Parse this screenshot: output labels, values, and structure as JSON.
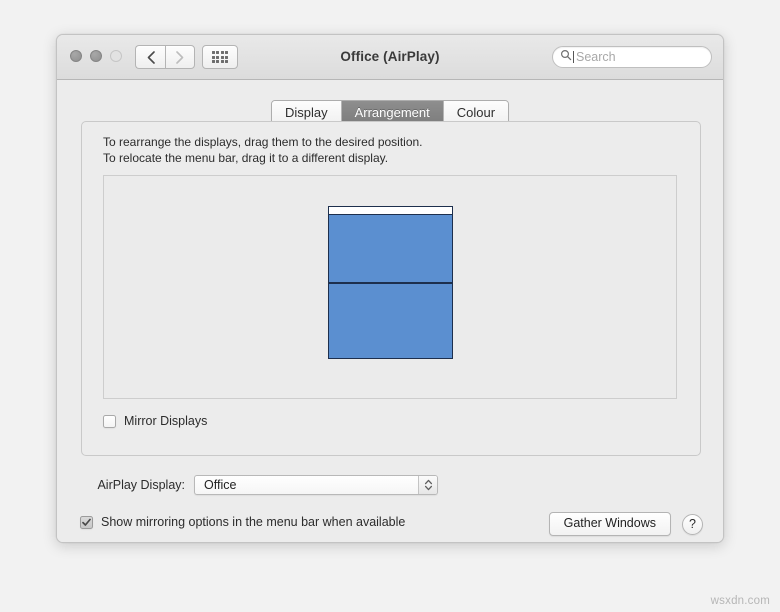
{
  "window": {
    "title": "Office (AirPlay)",
    "traffic_lights": [
      "close",
      "minimize",
      "zoom"
    ],
    "nav": {
      "back_label": "back-chevron",
      "forward_label": "forward-chevron",
      "show_all_label": "show-all-grid"
    },
    "search": {
      "placeholder": "Search",
      "value": ""
    }
  },
  "tabs": [
    {
      "label": "Display",
      "active": false
    },
    {
      "label": "Arrangement",
      "active": true
    },
    {
      "label": "Colour",
      "active": false
    }
  ],
  "arrangement": {
    "hint_line1": "To rearrange the displays, drag them to the desired position.",
    "hint_line2": "To relocate the menu bar, drag it to a different display.",
    "displays": [
      {
        "name": "primary-display",
        "has_menu_bar": true
      },
      {
        "name": "secondary-display",
        "has_menu_bar": false
      }
    ],
    "mirror_displays": {
      "label": "Mirror Displays",
      "checked": false
    }
  },
  "airplay": {
    "label": "AirPlay Display:",
    "selected": "Office",
    "options": [
      "Office"
    ]
  },
  "footer": {
    "show_mirroring": {
      "label": "Show mirroring options in the menu bar when available",
      "checked": true
    },
    "gather_windows_label": "Gather Windows",
    "help_label": "?"
  },
  "watermark": "wsxdn.com",
  "colors": {
    "display_blue": "#5b8fd0",
    "display_border": "#1d2f4d",
    "window_bg": "#ececec",
    "tab_active_bg": "#838383"
  }
}
